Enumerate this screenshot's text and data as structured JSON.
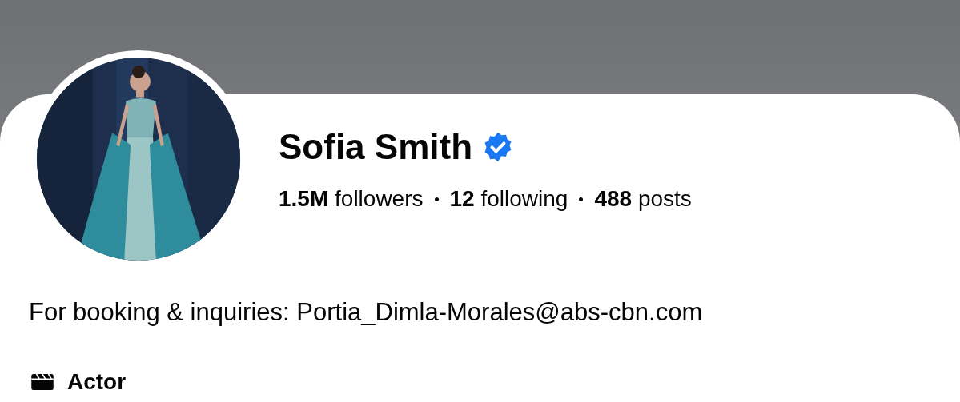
{
  "profile": {
    "name": "Sofia Smith",
    "verified": true,
    "stats": [
      "**1.5M** followers",
      "**12** following",
      "**488** posts"
    ],
    "bio": "For booking & inquiries: Portia_Dimla-Morales@abs-cbn.com",
    "details": [
      {
        "kind": "category",
        "text": "Actor"
      }
    ]
  }
}
